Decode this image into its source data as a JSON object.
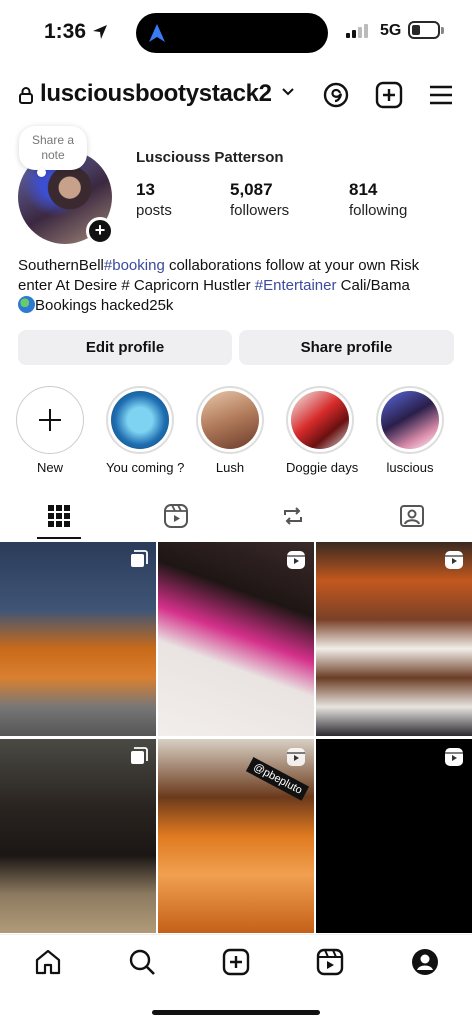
{
  "status_bar": {
    "time": "1:36",
    "network": "5G"
  },
  "header": {
    "username": "lusciousbootystack2"
  },
  "profile": {
    "note_placeholder": "Share a note",
    "display_name": "Lusciouss Patterson",
    "stats": {
      "posts": {
        "count": "13",
        "label": "posts"
      },
      "followers": {
        "count": "5,087",
        "label": "followers"
      },
      "following": {
        "count": "814",
        "label": "following"
      }
    },
    "bio": {
      "line1_a": "SouthernBell",
      "line1_tag": "#booking",
      "line1_b": " collaborations follow at your own  Risk",
      "line2_a": "enter At Desire # Capricorn Hustler ",
      "line2_tag": "#Entertainer",
      "line2_b": " Cali/Bama",
      "line3": "Bookings  hacked25k"
    },
    "buttons": {
      "edit": "Edit profile",
      "share": "Share profile"
    }
  },
  "highlights": [
    {
      "label": "New"
    },
    {
      "label": "You coming ?"
    },
    {
      "label": "Lush"
    },
    {
      "label": "Doggie days"
    },
    {
      "label": "luscious"
    }
  ],
  "tabs": [
    "grid-icon",
    "reels-icon",
    "reposts-icon",
    "tagged-icon"
  ],
  "grid": {
    "posts": [
      {
        "type": "carousel"
      },
      {
        "type": "reel"
      },
      {
        "type": "reel"
      },
      {
        "type": "carousel"
      },
      {
        "type": "reel",
        "caption_text": "@pbepluto"
      },
      {
        "type": "reel"
      }
    ]
  },
  "bottom_nav": [
    "home-icon",
    "search-icon",
    "create-icon",
    "reels-icon",
    "profile-icon"
  ],
  "colors": {
    "hashtag": "#3b4a9e",
    "button_bg": "#efeff1",
    "island_accent": "#3a7bf6"
  }
}
